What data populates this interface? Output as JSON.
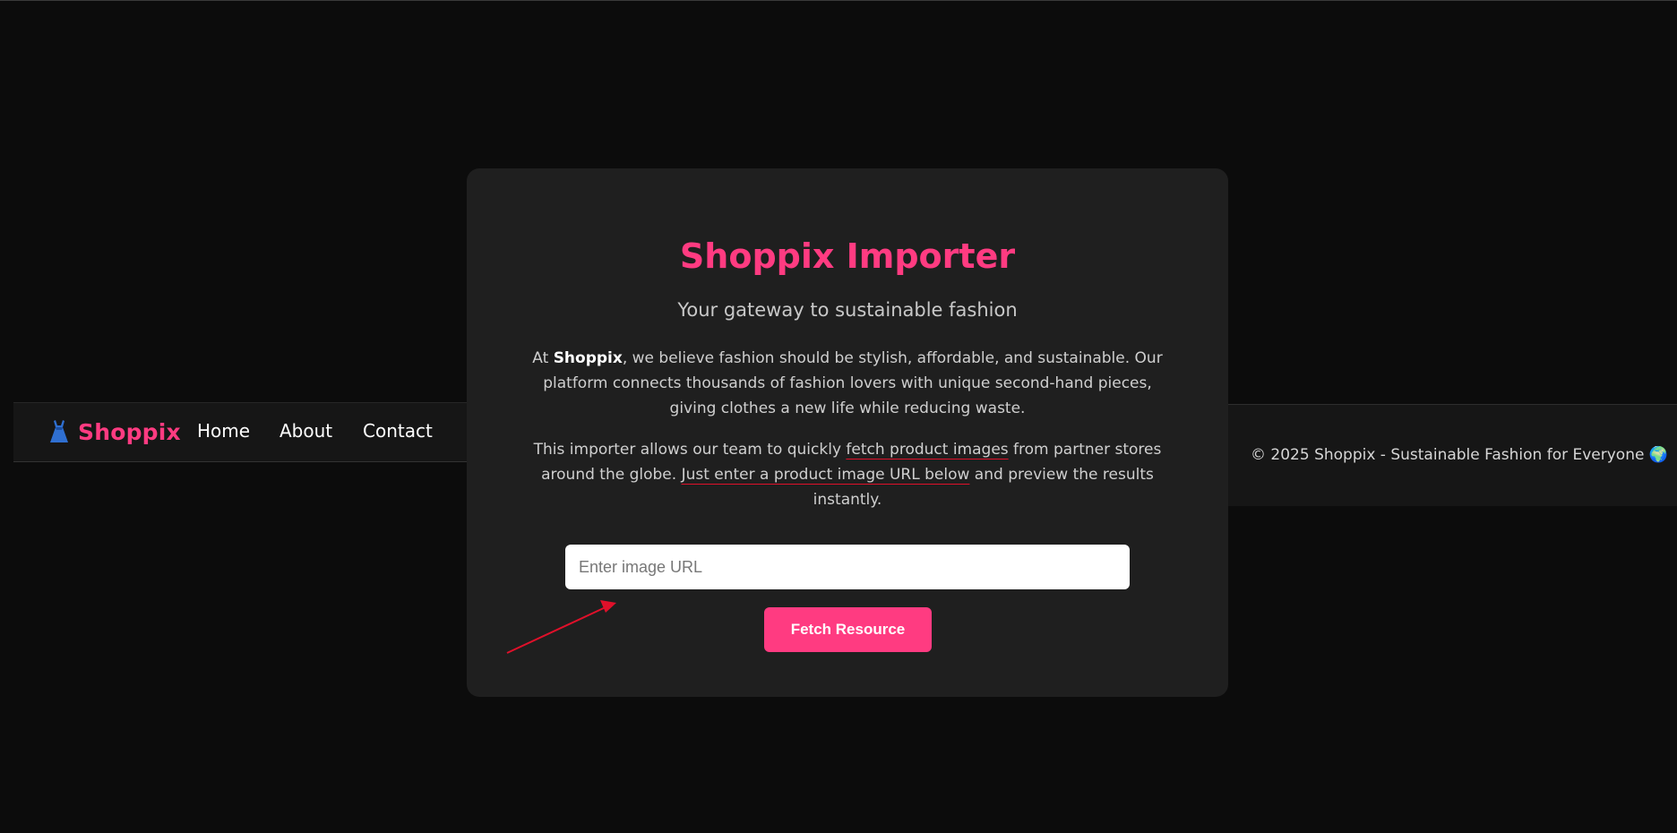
{
  "navbar": {
    "brand_emoji": "👗",
    "brand_name": "Shoppix",
    "links": [
      "Home",
      "About",
      "Contact"
    ]
  },
  "card": {
    "title": "Shoppix Importer",
    "subtitle": "Your gateway to sustainable fashion",
    "para1": {
      "prefix": "At ",
      "brand": "Shoppix",
      "suffix": ", we believe fashion should be stylish, affordable, and sustainable. Our platform connects thousands of fashion lovers with unique second-hand pieces, giving clothes a new life while reducing waste."
    },
    "para2": {
      "part1": "This importer allows our team to quickly ",
      "highlight1": "fetch product images",
      "part2": " from partner stores around the globe. ",
      "highlight2": "Just enter a product image URL below",
      "part3": " and preview the results instantly."
    },
    "input_placeholder": "Enter image URL",
    "input_value": "",
    "button_label": "Fetch Resource"
  },
  "footer": {
    "text": "© 2025 Shoppix - Sustainable Fashion for Everyone 🌍"
  },
  "colors": {
    "brand_pink": "#ff3b81",
    "background": "#0c0c0c",
    "card": "#1f1f1f",
    "annotation_red": "#e0102a"
  },
  "icons": {
    "brand": "dress-icon",
    "annotation": "red-arrow-icon"
  }
}
